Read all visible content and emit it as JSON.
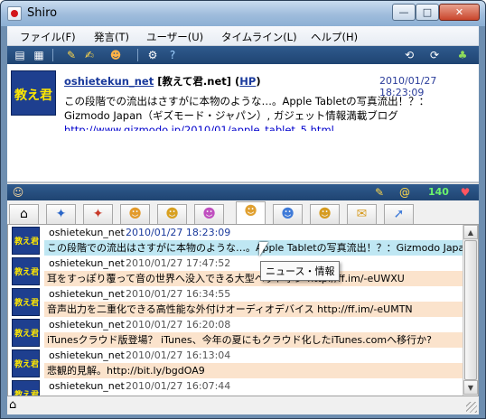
{
  "window": {
    "title": "Shiro",
    "min": "—",
    "max": "□",
    "close": "✕"
  },
  "menu": [
    {
      "label": "ファイル(F)"
    },
    {
      "label": "発言(T)"
    },
    {
      "label": "ユーザー(U)"
    },
    {
      "label": "タイムライン(L)"
    },
    {
      "label": "ヘルプ(H)"
    }
  ],
  "detail": {
    "avatar_text": "教え君",
    "user_link": "oshietekun_net",
    "display_name": " [教えて君.net] (",
    "hp_link": "HP",
    "close_paren": ")",
    "time": "2010/01/27 18:23:09",
    "text_line1": "この段階での流出はさすがに本物のような…。Apple Tabletの写真流出！？：",
    "text_line2": "Gizmodo Japan（ギズモード・ジャパン）, ガジェット情報満載ブログ",
    "url": "http://www.gizmodo.jp/2010/01/apple_tablet_5.html"
  },
  "status": {
    "count": "140"
  },
  "tooltip": "ニュース・情報",
  "timeline": [
    {
      "user": "oshietekun_net",
      "time": "2010/01/27 18:23:09",
      "text": "この段階での流出はさすがに本物のような…。Apple Tabletの写真流出！？：Gizmodo Japan（",
      "selected": true
    },
    {
      "user": "oshietekun_net",
      "time": "2010/01/27 17:47:52",
      "text": "耳をすっぽり覆って音の世界へ没入できる大型ヘッドホン http://ff.im/-eUWXU"
    },
    {
      "user": "oshietekun_net",
      "time": "2010/01/27 16:34:55",
      "text": "音声出力を二重化できる高性能な外付けオーディオデバイス http://ff.im/-eUMTN"
    },
    {
      "user": "oshietekun_net",
      "time": "2010/01/27 16:20:08",
      "text": "iTunesクラウド版登場？ iTunes、今年の夏にもクラウド化したiTunes.comへ移行か?"
    },
    {
      "user": "oshietekun_net",
      "time": "2010/01/27 16:13:04",
      "text": "悲観的見解。http://bit.ly/bgdOA9"
    },
    {
      "user": "oshietekun_net",
      "time": "2010/01/27 16:07:44",
      "text": ""
    }
  ]
}
